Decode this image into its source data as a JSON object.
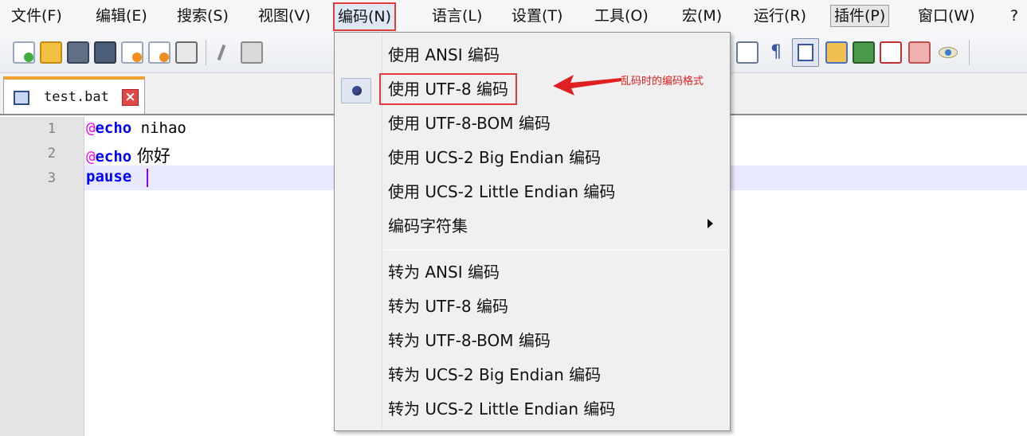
{
  "menubar": {
    "items": [
      "文件(F)",
      "编辑(E)",
      "搜索(S)",
      "视图(V)",
      "编码(N)",
      "语言(L)",
      "设置(T)",
      "工具(O)",
      "宏(M)",
      "运行(R)",
      "插件(P)",
      "窗口(W)",
      "?"
    ],
    "active_item": "编码(N)"
  },
  "tab": {
    "label": "test.bat",
    "close_glyph": "×"
  },
  "editor": {
    "lines": [
      {
        "no": "1",
        "at": "@",
        "keyword": "echo",
        "rest": " nihao"
      },
      {
        "no": "2",
        "at": "@",
        "keyword": "echo",
        "rest": " 你好"
      },
      {
        "no": "3",
        "at": "",
        "keyword": "pause",
        "rest": ""
      }
    ]
  },
  "encoding_menu": {
    "items": [
      "使用 ANSI 编码",
      "使用 UTF-8 编码",
      "使用 UTF-8-BOM 编码",
      "使用 UCS-2 Big Endian 编码",
      "使用 UCS-2 Little Endian 编码",
      "编码字符集",
      "转为 ANSI 编码",
      "转为 UTF-8 编码",
      "转为 UTF-8-BOM 编码",
      "转为 UCS-2 Big Endian 编码",
      "转为 UCS-2 Little Endian 编码"
    ],
    "selected": "使用 UTF-8 编码"
  },
  "annotation": {
    "text": "乱码时的编码格式",
    "color": "#e02020"
  },
  "colors": {
    "accent_red": "#e23b3b",
    "keyword_blue": "#0000ff",
    "at_magenta": "#ff00ff",
    "tab_orange": "#f0a030"
  }
}
